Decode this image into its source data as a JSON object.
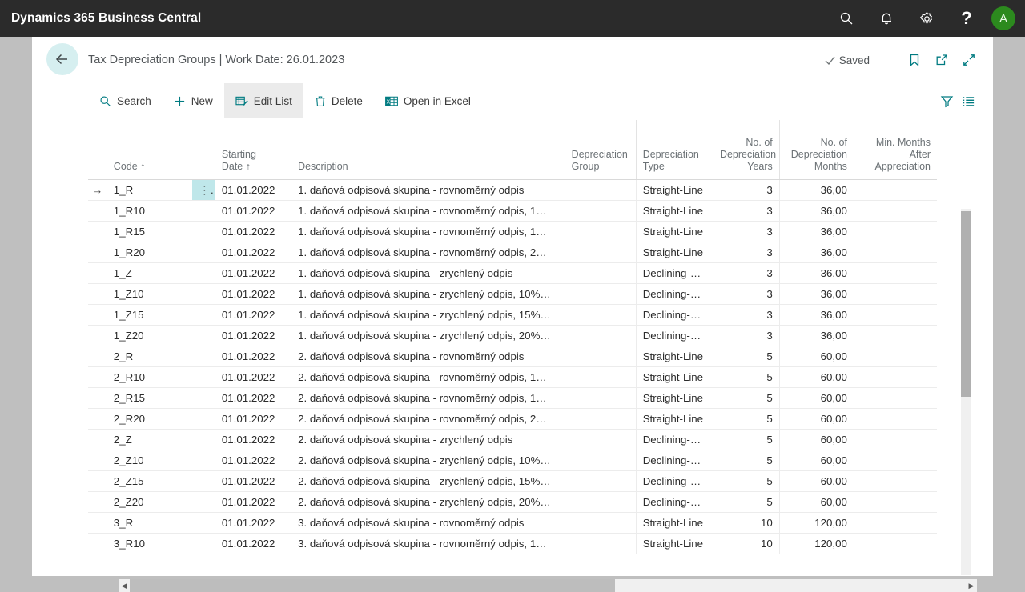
{
  "topbar": {
    "brand": "Dynamics 365 Business Central",
    "icons": [
      {
        "name": "search-icon",
        "label": "Search"
      },
      {
        "name": "notification-bell-icon",
        "label": "Notifications"
      },
      {
        "name": "gear-icon",
        "label": "Settings"
      },
      {
        "name": "help-question-icon",
        "label": "?"
      }
    ],
    "avatar_initial": "A",
    "avatar_color": "#2c8a1e",
    "background": "#2b2b2b"
  },
  "page": {
    "title": "Tax Depreciation Groups | Work Date: 26.01.2023",
    "back_label": "Back",
    "save_status": "Saved",
    "header_icons": [
      {
        "name": "bookmark-icon",
        "label": "Bookmark"
      },
      {
        "name": "open-in-new-window-icon",
        "label": "Open in new window"
      },
      {
        "name": "collapse-icon",
        "label": "Collapse"
      }
    ]
  },
  "toolbar": {
    "items": [
      {
        "label": "Search",
        "icon": "search-icon",
        "active": false
      },
      {
        "label": "New",
        "icon": "plus-icon",
        "active": false
      },
      {
        "label": "Edit List",
        "icon": "edit-list-icon",
        "active": true
      },
      {
        "label": "Delete",
        "icon": "trash-icon",
        "active": false
      },
      {
        "label": "Open in Excel",
        "icon": "excel-icon",
        "active": false
      }
    ],
    "right_icons": [
      {
        "name": "filter-funnel-icon",
        "label": "Filter"
      },
      {
        "name": "list-view-icon",
        "label": "Choose columns"
      }
    ],
    "accent": "#007b81"
  },
  "table": {
    "columns": [
      {
        "key": "code",
        "label": "Code ↑",
        "align": "left"
      },
      {
        "key": "starting_date",
        "label": "Starting\nDate ↑",
        "align": "left"
      },
      {
        "key": "description",
        "label": "Description",
        "align": "left"
      },
      {
        "key": "depreciation_group",
        "label": "Depreciation\nGroup",
        "align": "left"
      },
      {
        "key": "depreciation_type",
        "label": "Depreciation\nType",
        "align": "left"
      },
      {
        "key": "no_of_depreciation_years",
        "label": "No. of\nDepreciation\nYears",
        "align": "right"
      },
      {
        "key": "no_of_depreciation_months",
        "label": "No. of\nDepreciation\nMonths",
        "align": "right"
      },
      {
        "key": "min_months_after_appreciation",
        "label": "Min. Months\nAfter\nAppreciation",
        "align": "right"
      }
    ],
    "headers": {
      "code": "Code ↑",
      "starting_date_l1": "Starting",
      "starting_date_l2": "Date ↑",
      "description": "Description",
      "group_l1": "Depreciation",
      "group_l2": "Group",
      "type_l1": "Depreciation",
      "type_l2": "Type",
      "years_l1": "No. of",
      "years_l2": "Depreciation",
      "years_l3": "Years",
      "months_l1": "No. of",
      "months_l2": "Depreciation",
      "months_l3": "Months",
      "min_l1": "Min. Months",
      "min_l2": "After",
      "min_l3": "Appreciation"
    },
    "row_indicator": "→",
    "row_menu_glyph": "⋮",
    "selected_row_index": 0,
    "selection_color": "#bfe7ea",
    "rows": [
      {
        "code": "1_R",
        "starting_date": "01.01.2022",
        "description": "1. daňová odpisová skupina - rovnoměrný odpis",
        "depreciation_group": "",
        "depreciation_type": "Straight-Line",
        "no_of_depreciation_years": "3",
        "no_of_depreciation_months": "36,00",
        "min_months_after_appreciation": ""
      },
      {
        "code": "1_R10",
        "starting_date": "01.01.2022",
        "description": "1. daňová odpisová skupina - rovnoměrný odpis, 1…",
        "depreciation_group": "",
        "depreciation_type": "Straight-Line",
        "no_of_depreciation_years": "3",
        "no_of_depreciation_months": "36,00",
        "min_months_after_appreciation": ""
      },
      {
        "code": "1_R15",
        "starting_date": "01.01.2022",
        "description": "1. daňová odpisová skupina - rovnoměrný odpis, 1…",
        "depreciation_group": "",
        "depreciation_type": "Straight-Line",
        "no_of_depreciation_years": "3",
        "no_of_depreciation_months": "36,00",
        "min_months_after_appreciation": ""
      },
      {
        "code": "1_R20",
        "starting_date": "01.01.2022",
        "description": "1. daňová odpisová skupina - rovnoměrný odpis, 2…",
        "depreciation_group": "",
        "depreciation_type": "Straight-Line",
        "no_of_depreciation_years": "3",
        "no_of_depreciation_months": "36,00",
        "min_months_after_appreciation": ""
      },
      {
        "code": "1_Z",
        "starting_date": "01.01.2022",
        "description": "1. daňová odpisová skupina - zrychlený odpis",
        "depreciation_group": "",
        "depreciation_type": "Declining-B…",
        "no_of_depreciation_years": "3",
        "no_of_depreciation_months": "36,00",
        "min_months_after_appreciation": ""
      },
      {
        "code": "1_Z10",
        "starting_date": "01.01.2022",
        "description": "1. daňová odpisová skupina - zrychlený odpis, 10%…",
        "depreciation_group": "",
        "depreciation_type": "Declining-B…",
        "no_of_depreciation_years": "3",
        "no_of_depreciation_months": "36,00",
        "min_months_after_appreciation": ""
      },
      {
        "code": "1_Z15",
        "starting_date": "01.01.2022",
        "description": "1. daňová odpisová skupina - zrychlený odpis, 15%…",
        "depreciation_group": "",
        "depreciation_type": "Declining-B…",
        "no_of_depreciation_years": "3",
        "no_of_depreciation_months": "36,00",
        "min_months_after_appreciation": ""
      },
      {
        "code": "1_Z20",
        "starting_date": "01.01.2022",
        "description": "1. daňová odpisová skupina - zrychlený odpis, 20%…",
        "depreciation_group": "",
        "depreciation_type": "Declining-B…",
        "no_of_depreciation_years": "3",
        "no_of_depreciation_months": "36,00",
        "min_months_after_appreciation": ""
      },
      {
        "code": "2_R",
        "starting_date": "01.01.2022",
        "description": "2. daňová odpisová skupina - rovnoměrný odpis",
        "depreciation_group": "",
        "depreciation_type": "Straight-Line",
        "no_of_depreciation_years": "5",
        "no_of_depreciation_months": "60,00",
        "min_months_after_appreciation": ""
      },
      {
        "code": "2_R10",
        "starting_date": "01.01.2022",
        "description": "2. daňová odpisová skupina - rovnoměrný odpis, 1…",
        "depreciation_group": "",
        "depreciation_type": "Straight-Line",
        "no_of_depreciation_years": "5",
        "no_of_depreciation_months": "60,00",
        "min_months_after_appreciation": ""
      },
      {
        "code": "2_R15",
        "starting_date": "01.01.2022",
        "description": "2. daňová odpisová skupina - rovnoměrný odpis, 1…",
        "depreciation_group": "",
        "depreciation_type": "Straight-Line",
        "no_of_depreciation_years": "5",
        "no_of_depreciation_months": "60,00",
        "min_months_after_appreciation": ""
      },
      {
        "code": "2_R20",
        "starting_date": "01.01.2022",
        "description": "2. daňová odpisová skupina - rovnoměrný odpis, 2…",
        "depreciation_group": "",
        "depreciation_type": "Straight-Line",
        "no_of_depreciation_years": "5",
        "no_of_depreciation_months": "60,00",
        "min_months_after_appreciation": ""
      },
      {
        "code": "2_Z",
        "starting_date": "01.01.2022",
        "description": "2. daňová odpisová skupina - zrychlený odpis",
        "depreciation_group": "",
        "depreciation_type": "Declining-B…",
        "no_of_depreciation_years": "5",
        "no_of_depreciation_months": "60,00",
        "min_months_after_appreciation": ""
      },
      {
        "code": "2_Z10",
        "starting_date": "01.01.2022",
        "description": "2. daňová odpisová skupina - zrychlený odpis, 10%…",
        "depreciation_group": "",
        "depreciation_type": "Declining-B…",
        "no_of_depreciation_years": "5",
        "no_of_depreciation_months": "60,00",
        "min_months_after_appreciation": ""
      },
      {
        "code": "2_Z15",
        "starting_date": "01.01.2022",
        "description": "2. daňová odpisová skupina - zrychlený odpis, 15%…",
        "depreciation_group": "",
        "depreciation_type": "Declining-B…",
        "no_of_depreciation_years": "5",
        "no_of_depreciation_months": "60,00",
        "min_months_after_appreciation": ""
      },
      {
        "code": "2_Z20",
        "starting_date": "01.01.2022",
        "description": "2. daňová odpisová skupina - zrychlený odpis, 20%…",
        "depreciation_group": "",
        "depreciation_type": "Declining-B…",
        "no_of_depreciation_years": "5",
        "no_of_depreciation_months": "60,00",
        "min_months_after_appreciation": ""
      },
      {
        "code": "3_R",
        "starting_date": "01.01.2022",
        "description": "3. daňová odpisová skupina - rovnoměrný odpis",
        "depreciation_group": "",
        "depreciation_type": "Straight-Line",
        "no_of_depreciation_years": "10",
        "no_of_depreciation_months": "120,00",
        "min_months_after_appreciation": ""
      },
      {
        "code": "3_R10",
        "starting_date": "01.01.2022",
        "description": "3. daňová odpisová skupina - rovnoměrný odpis, 1…",
        "depreciation_group": "",
        "depreciation_type": "Straight-Line",
        "no_of_depreciation_years": "10",
        "no_of_depreciation_months": "120,00",
        "min_months_after_appreciation": ""
      }
    ]
  },
  "scrollbars": {
    "vertical": {
      "thumb_top_pct": 0,
      "thumb_height_pct": 51
    },
    "horizontal": {
      "thumb_left_pct": 0,
      "thumb_width_pct": 57,
      "left_arrow": "◀",
      "right_arrow": "▶"
    }
  }
}
